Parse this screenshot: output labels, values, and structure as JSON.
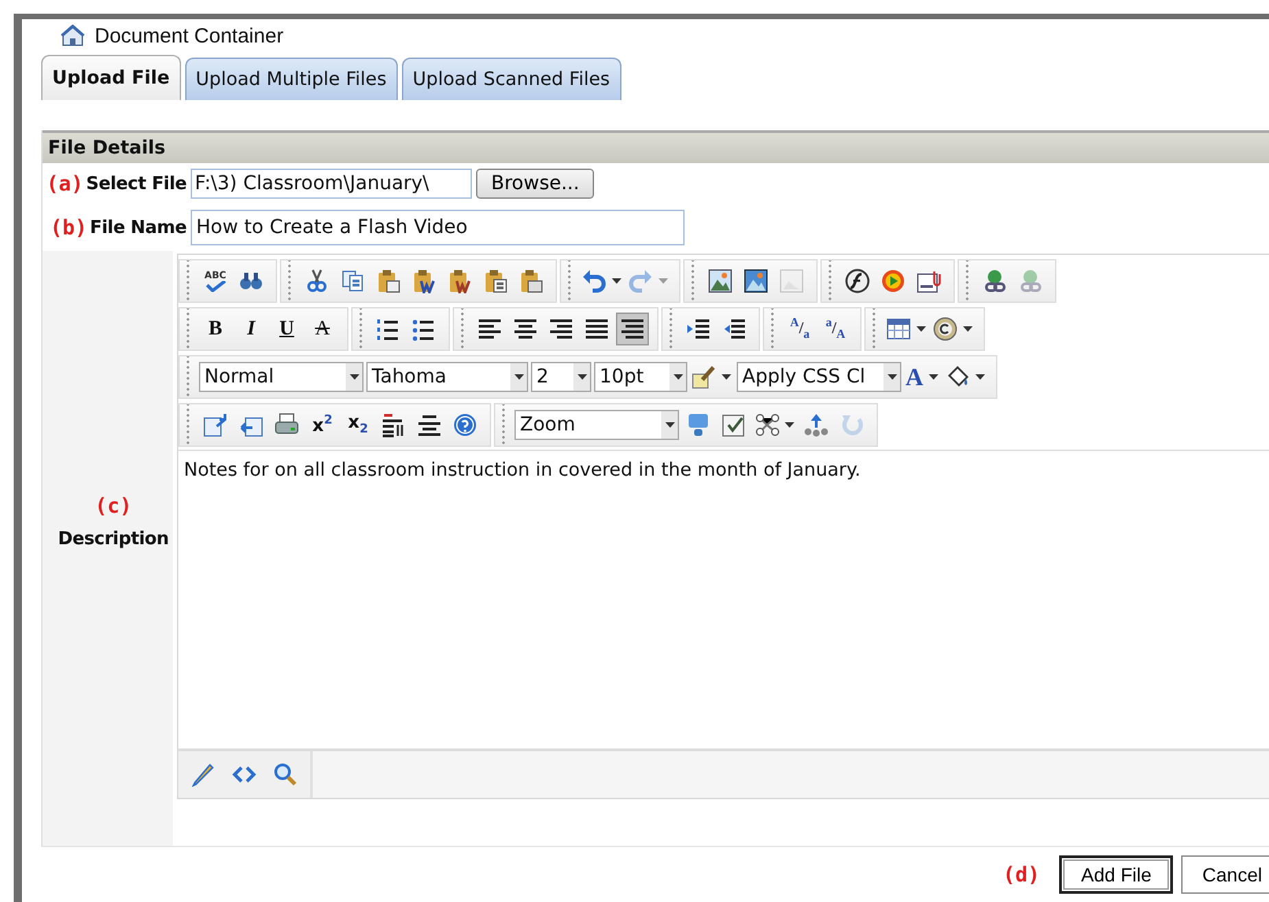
{
  "window": {
    "title": "Document Container"
  },
  "tabs": [
    {
      "label": "Upload File",
      "selected": true
    },
    {
      "label": "Upload Multiple Files",
      "selected": false
    },
    {
      "label": "Upload Scanned Files",
      "selected": false
    }
  ],
  "section": {
    "title": "File Details"
  },
  "fields": [
    {
      "marker": "(a)",
      "label": "Select File",
      "kind": "file",
      "value": "F:\\3) Classroom\\January\\",
      "button": "Browse..."
    },
    {
      "marker": "(b)",
      "label": "File Name",
      "kind": "text",
      "value": "How to Create a Flash Video"
    }
  ],
  "description": {
    "marker": "(c)",
    "label": "Description",
    "toolbar": [
      [
        [
          {
            "kind": "spellcheck",
            "label": "ABC",
            "disabled": false,
            "selected": false,
            "dropdown": false
          },
          {
            "kind": "find",
            "disabled": false,
            "selected": false,
            "dropdown": false
          }
        ],
        [
          {
            "kind": "cut",
            "disabled": false,
            "selected": false,
            "dropdown": false
          },
          {
            "kind": "copy",
            "disabled": false,
            "selected": false,
            "dropdown": false
          },
          {
            "kind": "paste",
            "disabled": false,
            "selected": false,
            "dropdown": false
          },
          {
            "kind": "pasteword",
            "disabled": false,
            "selected": false,
            "dropdown": false
          },
          {
            "kind": "pastecleanword",
            "disabled": false,
            "selected": false,
            "dropdown": false
          },
          {
            "kind": "pastetext",
            "disabled": false,
            "selected": false,
            "dropdown": false
          },
          {
            "kind": "pastehtml",
            "disabled": false,
            "selected": false,
            "dropdown": false
          }
        ],
        [
          {
            "kind": "undo",
            "disabled": false,
            "selected": false,
            "dropdown": true
          },
          {
            "kind": "redo",
            "disabled": true,
            "selected": false,
            "dropdown": true
          }
        ],
        [
          {
            "kind": "image",
            "disabled": false,
            "selected": false,
            "dropdown": false
          },
          {
            "kind": "imagemap",
            "disabled": false,
            "selected": false,
            "dropdown": false
          },
          {
            "kind": "imageprops",
            "disabled": true,
            "selected": false,
            "dropdown": false
          }
        ],
        [
          {
            "kind": "flash",
            "disabled": false,
            "selected": false,
            "dropdown": false
          },
          {
            "kind": "media",
            "disabled": false,
            "selected": false,
            "dropdown": false
          },
          {
            "kind": "document",
            "disabled": false,
            "selected": false,
            "dropdown": false
          }
        ],
        [
          {
            "kind": "link",
            "disabled": false,
            "selected": false,
            "dropdown": false
          },
          {
            "kind": "unlink",
            "disabled": true,
            "selected": false,
            "dropdown": false
          }
        ]
      ],
      [
        [
          {
            "kind": "bold",
            "label": "B",
            "disabled": false,
            "selected": false,
            "dropdown": false
          },
          {
            "kind": "italic",
            "label": "I",
            "disabled": false,
            "selected": false,
            "dropdown": false
          },
          {
            "kind": "underline",
            "label": "U",
            "disabled": false,
            "selected": false,
            "dropdown": false
          },
          {
            "kind": "strike",
            "label": "A",
            "disabled": false,
            "selected": false,
            "dropdown": false
          }
        ],
        [
          {
            "kind": "numbered",
            "disabled": false,
            "selected": false,
            "dropdown": false
          },
          {
            "kind": "bulleted",
            "disabled": false,
            "selected": false,
            "dropdown": false
          }
        ],
        [
          {
            "kind": "alignleft",
            "disabled": false,
            "selected": false,
            "dropdown": false
          },
          {
            "kind": "aligncenter",
            "disabled": false,
            "selected": false,
            "dropdown": false
          },
          {
            "kind": "alignright",
            "disabled": false,
            "selected": false,
            "dropdown": false
          },
          {
            "kind": "justify",
            "disabled": false,
            "selected": false,
            "dropdown": false
          },
          {
            "kind": "alignnone",
            "disabled": false,
            "selected": true,
            "dropdown": false
          }
        ],
        [
          {
            "kind": "indent",
            "disabled": false,
            "selected": false,
            "dropdown": false
          },
          {
            "kind": "outdent",
            "disabled": false,
            "selected": false,
            "dropdown": false
          }
        ],
        [
          {
            "kind": "grow",
            "label": "$^{A}$/$_{a}$",
            "disabled": false,
            "selected": false,
            "dropdown": false
          },
          {
            "kind": "shrink",
            "label": "$^{a}$/$_{A}$",
            "disabled": false,
            "selected": false,
            "dropdown": false
          }
        ],
        [
          {
            "kind": "table",
            "disabled": false,
            "selected": false,
            "dropdown": true
          },
          {
            "kind": "symbol",
            "disabled": false,
            "selected": false,
            "dropdown": true
          }
        ]
      ],
      [
        [
          {
            "kind": "select",
            "value": "Normal"
          },
          {
            "kind": "select",
            "value": "Tahoma"
          },
          {
            "kind": "select",
            "value": "2"
          },
          {
            "kind": "select",
            "value": "10pt"
          },
          {
            "kind": "painter",
            "disabled": false,
            "selected": false,
            "dropdown": true
          },
          {
            "kind": "select",
            "value": "Apply CSS Cl"
          },
          {
            "kind": "forecolor",
            "label": "A",
            "disabled": false,
            "selected": false,
            "dropdown": true
          },
          {
            "kind": "backcolor",
            "disabled": false,
            "selected": false,
            "dropdown": true
          }
        ]
      ],
      [
        [
          {
            "kind": "template",
            "disabled": false,
            "selected": false,
            "dropdown": false
          },
          {
            "kind": "import",
            "disabled": false,
            "selected": false,
            "dropdown": false
          },
          {
            "kind": "print",
            "disabled": false,
            "selected": false,
            "dropdown": false
          },
          {
            "kind": "superscript",
            "label": "x$^{2}$",
            "disabled": false,
            "selected": false,
            "dropdown": false
          },
          {
            "kind": "subscript",
            "label": "x$_{2}$",
            "disabled": false,
            "selected": false,
            "dropdown": false
          },
          {
            "kind": "paragraph",
            "disabled": false,
            "selected": false,
            "dropdown": false
          },
          {
            "kind": "formatblock",
            "disabled": false,
            "selected": false,
            "dropdown": false
          },
          {
            "kind": "help",
            "disabled": false,
            "selected": false,
            "dropdown": false
          }
        ],
        [
          {
            "kind": "select",
            "value": "Zoom"
          },
          {
            "kind": "module",
            "disabled": false,
            "selected": false,
            "dropdown": false
          },
          {
            "kind": "checkbox",
            "disabled": false,
            "selected": false,
            "dropdown": false
          },
          {
            "kind": "network",
            "disabled": false,
            "selected": false,
            "dropdown": true
          },
          {
            "kind": "tree",
            "disabled": false,
            "selected": false,
            "dropdown": false
          },
          {
            "kind": "repeat",
            "disabled": true,
            "selected": false,
            "dropdown": false
          }
        ]
      ]
    ],
    "content": "Notes for on all classroom instruction in covered in the month of January.",
    "modes": [
      {
        "kind": "design"
      },
      {
        "kind": "html"
      },
      {
        "kind": "preview"
      }
    ]
  },
  "actions": {
    "marker": "(d)",
    "buttons": [
      {
        "label": "Add File",
        "default": true
      },
      {
        "label": "Cancel",
        "default": false
      }
    ]
  }
}
